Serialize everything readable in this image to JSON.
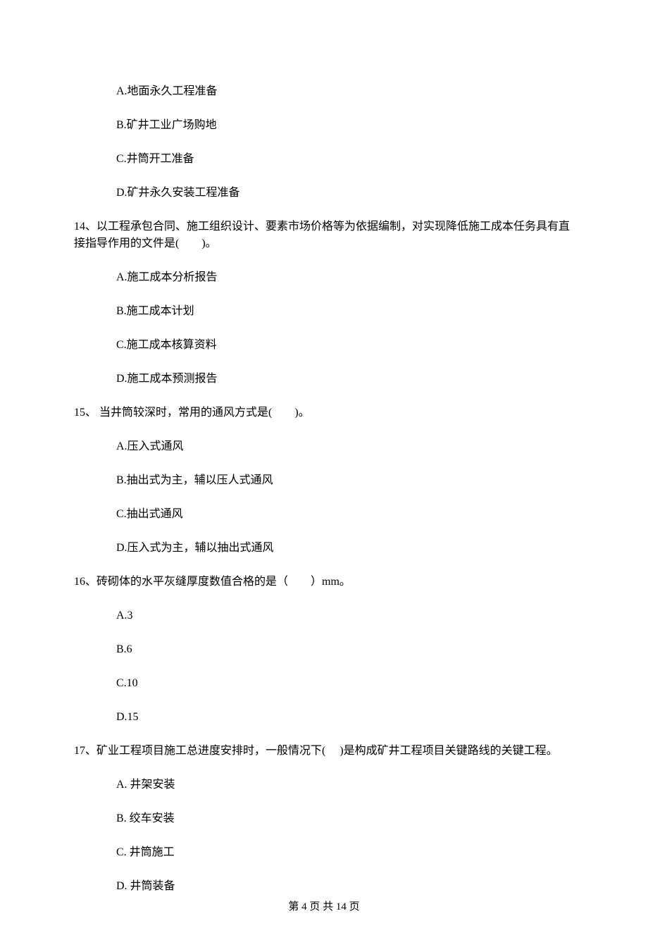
{
  "q13": {
    "options": {
      "a": "A.地面永久工程准备",
      "b": "B.矿井工业广场购地",
      "c": "C.井筒开工准备",
      "d": "D.矿井永久安装工程准备"
    }
  },
  "q14": {
    "text": "14、以工程承包合同、施工组织设计、要素市场价格等为依据编制，对实现降低施工成本任务具有直接指导作用的文件是(　　)。",
    "options": {
      "a": "A.施工成本分析报告",
      "b": "B.施工成本计划",
      "c": "C.施工成本核算资料",
      "d": "D.施工成本预测报告"
    }
  },
  "q15": {
    "text": "15、 当井筒较深时，常用的通风方式是(　　)。",
    "options": {
      "a": "A.压入式通风",
      "b": "B.抽出式为主，辅以压人式通风",
      "c": "C.抽出式通风",
      "d": "D.压入式为主，辅以抽出式通风"
    }
  },
  "q16": {
    "text": "16、砖砌体的水平灰缝厚度数值合格的是（　　）mm。",
    "options": {
      "a": "A.3",
      "b": "B.6",
      "c": "C.10",
      "d": "D.15"
    }
  },
  "q17": {
    "text": "17、矿业工程项目施工总进度安排时，一般情况下(　 )是构成矿井工程项目关键路线的关键工程。",
    "options": {
      "a": "A. 井架安装",
      "b": "B. 绞车安装",
      "c": "C. 井筒施工",
      "d": "D. 井筒装备"
    }
  },
  "footer": "第 4 页 共 14 页"
}
